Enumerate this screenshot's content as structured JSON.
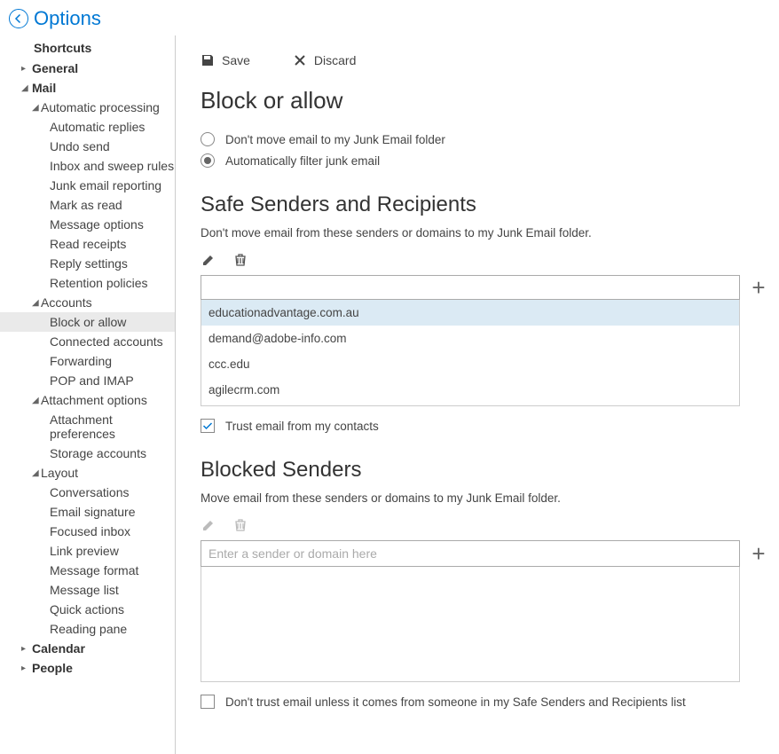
{
  "header": {
    "title": "Options"
  },
  "toolbar": {
    "save_label": "Save",
    "discard_label": "Discard"
  },
  "sidebar": {
    "shortcuts": "Shortcuts",
    "general": "General",
    "mail": "Mail",
    "calendar": "Calendar",
    "people": "People",
    "automatic_processing": {
      "label": "Automatic processing",
      "items": [
        "Automatic replies",
        "Undo send",
        "Inbox and sweep rules",
        "Junk email reporting",
        "Mark as read",
        "Message options",
        "Read receipts",
        "Reply settings",
        "Retention policies"
      ]
    },
    "accounts": {
      "label": "Accounts",
      "items": [
        "Block or allow",
        "Connected accounts",
        "Forwarding",
        "POP and IMAP"
      ]
    },
    "attachment_options": {
      "label": "Attachment options",
      "items": [
        "Attachment preferences",
        "Storage accounts"
      ]
    },
    "layout": {
      "label": "Layout",
      "items": [
        "Conversations",
        "Email signature",
        "Focused inbox",
        "Link preview",
        "Message format",
        "Message list",
        "Quick actions",
        "Reading pane"
      ]
    }
  },
  "page": {
    "title": "Block or allow",
    "radio1": "Don't move email to my Junk Email folder",
    "radio2": "Automatically filter junk email",
    "radio_selected": 2
  },
  "safe": {
    "title": "Safe Senders and Recipients",
    "desc": "Don't move email from these senders or domains to my Junk Email folder.",
    "input_value": "",
    "items": [
      "educationadvantage.com.au",
      "demand@adobe-info.com",
      "ccc.edu",
      "agilecrm.com"
    ],
    "selected_index": 0,
    "trust_label": "Trust email from my contacts",
    "trust_checked": true
  },
  "blocked": {
    "title": "Blocked Senders",
    "desc": "Move email from these senders or domains to my Junk Email folder.",
    "input_placeholder": "Enter a sender or domain here",
    "items": [],
    "dont_trust_label": "Don't trust email unless it comes from someone in my Safe Senders and Recipients list",
    "dont_trust_checked": false
  }
}
